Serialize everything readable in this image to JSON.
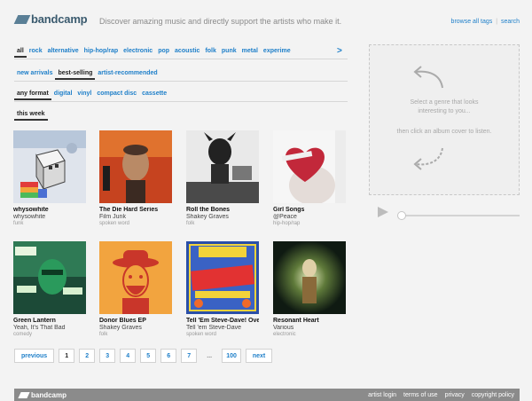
{
  "header": {
    "brand": "bandcamp",
    "tagline": "Discover amazing music and directly support the artists who make it.",
    "browse_tags": "browse all tags",
    "separator": "|",
    "search": "search"
  },
  "genres": [
    "all",
    "rock",
    "alternative",
    "hip-hop/rap",
    "electronic",
    "pop",
    "acoustic",
    "folk",
    "punk",
    "metal",
    "experime"
  ],
  "genre_next": ">",
  "sorts": [
    "new arrivals",
    "best-selling",
    "artist-recommended"
  ],
  "formats": [
    "any format",
    "digital",
    "vinyl",
    "compact disc",
    "cassette"
  ],
  "time": "this week",
  "albums": [
    {
      "title": "whysowhite",
      "artist": "whysowhite",
      "genre": "funk"
    },
    {
      "title": "The Die Hard Series",
      "artist": "Film Junk",
      "genre": "spoken word"
    },
    {
      "title": "Roll the Bones",
      "artist": "Shakey Graves",
      "genre": "folk"
    },
    {
      "title": "Girl Songs",
      "artist": "@Peace",
      "genre": "hip-hop/rap"
    },
    {
      "title": "Green Lantern",
      "artist": "Yeah, It's That Bad",
      "genre": "comedy"
    },
    {
      "title": "Donor Blues EP",
      "artist": "Shakey Graves",
      "genre": "folk"
    },
    {
      "title": "Tell 'Em Steve-Dave! Overkill Episodes",
      "artist": "Tell 'em Steve-Dave",
      "genre": "spoken word"
    },
    {
      "title": "Resonant Heart",
      "artist": "Various",
      "genre": "electronic"
    }
  ],
  "pager": {
    "previous": "previous",
    "pages": [
      "1",
      "2",
      "3",
      "4",
      "5",
      "6",
      "7"
    ],
    "dots": "...",
    "last": "100",
    "next": "next"
  },
  "player": {
    "hint1": "Select a genre that looks",
    "hint2": "interesting to you...",
    "hint3": "then click an album cover to listen."
  },
  "footer": {
    "brand": "bandcamp",
    "links": [
      "artist login",
      "terms of use",
      "privacy",
      "copyright policy"
    ]
  }
}
